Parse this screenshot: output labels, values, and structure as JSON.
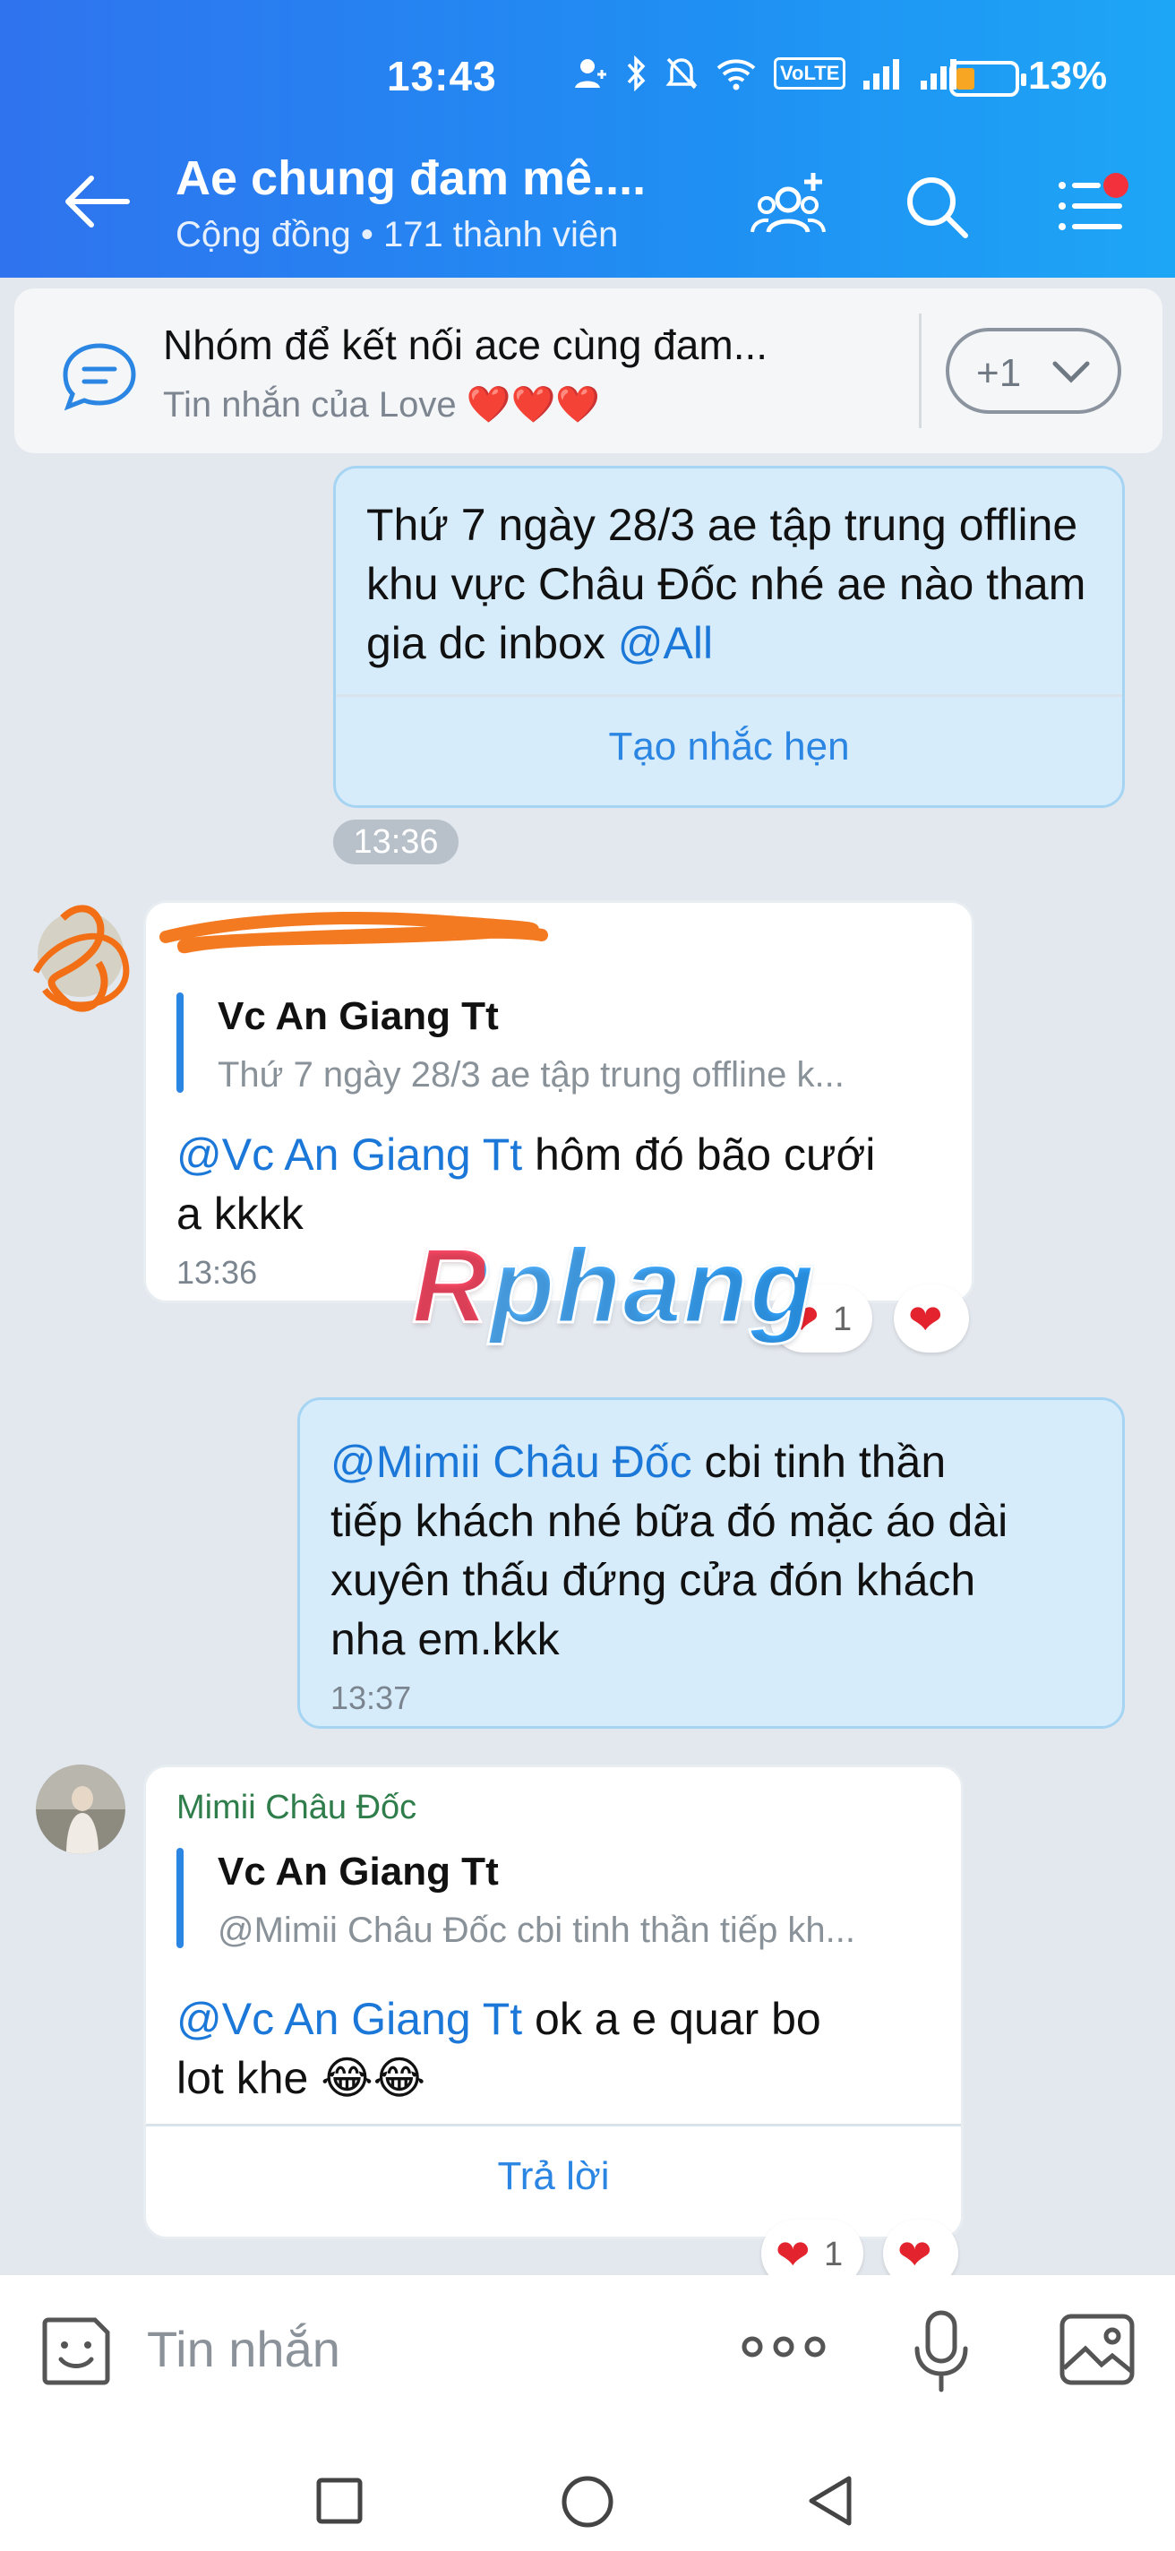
{
  "status_bar": {
    "time": "13:43",
    "battery": "13%",
    "volte": "VoLTE"
  },
  "header": {
    "title": "Ae chung đam mê....",
    "subtitle": "Cộng đồng • 171 thành viên"
  },
  "pinned": {
    "title": "Nhóm để kết nối ace cùng đam...",
    "subtitle": "Tin nhắn của Love ❤️❤️❤️",
    "more_label": "+1"
  },
  "messages": {
    "m1": {
      "text": "Thứ 7 ngày 28/3 ae tập trung offline khu vực Châu Đốc nhé ae nào tham gia dc inbox",
      "mention": "@All",
      "action": "Tạo nhắc hẹn",
      "time": "13:36"
    },
    "m2": {
      "quote_name": "Vc An Giang Tt",
      "quote_text": "Thứ 7 ngày 28/3 ae tập trung offline k...",
      "mention": "@Vc An Giang Tt",
      "text_line1": " hôm đó bão cưới",
      "text_line2": "a kkkk",
      "time": "13:36",
      "reaction_count": "1"
    },
    "m3": {
      "mention": "@Mimii Châu Đốc",
      "text_line1": " cbi tinh thần",
      "text_line2": "tiếp khách nhé bữa đó mặc áo dài",
      "text_line3": "xuyên thấu đứng cửa đón khách",
      "text_line4": "nha em.kkk",
      "time": "13:37"
    },
    "m4": {
      "sender": "Mimii Châu Đốc",
      "quote_name": "Vc An Giang Tt",
      "quote_text": "@Mimii Châu Đốc cbi tinh thần tiếp kh...",
      "mention": "@Vc An Giang Tt",
      "text_line1": " ok a  e quar bo",
      "text_line2": "lot khe 😂😂",
      "action": "Trả lời",
      "reaction_count": "1"
    }
  },
  "watermark": "Rphang",
  "composer": {
    "placeholder": "Tin nhắn"
  },
  "colors": {
    "header": "#2f73ee",
    "mention": "#1c78d8",
    "outgoing_bubble": "#d7ecfb",
    "reaction": "#e3232d"
  },
  "icons": [
    "back-arrow-icon",
    "add-member-icon",
    "search-icon",
    "menu-icon",
    "chat-bubble-icon",
    "chevron-down-icon",
    "heart-icon",
    "sticker-icon",
    "more-icon",
    "mic-icon",
    "image-icon",
    "recents-icon",
    "home-icon",
    "back-nav-icon"
  ]
}
